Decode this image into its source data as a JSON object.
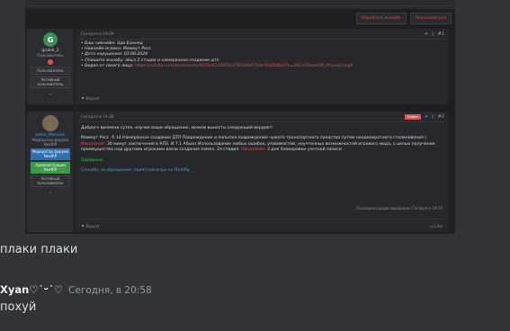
{
  "top_actions": {
    "goto_complaint": "Перейти к жалобе",
    "complain": "Пожаловаться"
  },
  "post1": {
    "user": {
      "initial": "G",
      "name": "grobik_2",
      "role": "Пользователь",
      "tags": [
        "Пользователь",
        "Активный пользователь"
      ],
      "avatar_color": "#3a8f57"
    },
    "timestamp": "Сегодня в 19:09",
    "number": "#1",
    "lines": [
      "• Ваш никнейм: Эди Баннед",
      "• Никнейм игрока: Маммут Росс",
      "• Дата нарушения: 03.08.2024",
      "• Опишите жалобу: абыз 2 стадия и намеренное создание дтп"
    ],
    "video_label": "• Видео от своего лица: ",
    "video_link": "https://rutube.ru/video/private/5059c63342f3e279f2e8857a6cf2a8b4b2/?p=2bEsoTwpeOM_8hwqqCnegA",
    "report": "Report"
  },
  "post2": {
    "user": {
      "name": "Julian_Mansoni",
      "role": "Модератор форума NextRP",
      "tags": [
        "Модератор форума NextRP",
        "Администрация NextRP",
        "Активный пользователь"
      ],
      "avatar_color": "#7a6a52"
    },
    "timestamp": "Сегодня в 19:28",
    "new_badge": "Новое",
    "number": "#2",
    "greeting": "Доброго времени суток, изучив ваше обращение, можем вынести следующий вердикт:",
    "verdict_a": "Маммут Росс -5.14 Намеренное создание ДТП Повреждение и попытка повреждения чужого транспортного средства путем неоднократного столкновения | ",
    "punish1": "Наказание:",
    "verdict_b": " 30 минут заключения в КПЗ. И 7.1 Абьюз Использование любых ошибок, уязвимостей, неучтенных возможностей игрового мода, с целью получения преимущества над другими игроками и/или создания помех. 2я стадия. ",
    "punish2": "Наказание:",
    "verdict_c": " 3 дня блокировки учетной записи",
    "approved": "Одобрено.",
    "thanks": "Спасибо за обращение, приятной игры на NextRp.",
    "edited": "Последнее редактирование: Сегодня в 19:29",
    "report": "Report",
    "like": "Like"
  },
  "chat": {
    "msg1": "плаки плаки",
    "author": "Xyan♡˙ᵕ˙♡",
    "time": "Сегодня, в 20:58",
    "msg2": "похуй"
  }
}
